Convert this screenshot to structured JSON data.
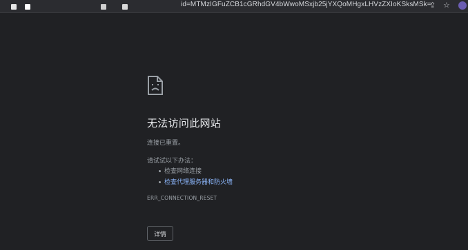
{
  "browser": {
    "url": "id=MTMzIGFuZCB1cGRhdGV4bWwoMSxjb25jYXQoMHgxLHVzZXIoKSksMSk=",
    "tab_colors": [
      "#e8e8e8",
      "#ffffff",
      "#cfcfcf",
      "#d8d8d8"
    ],
    "icons": [
      "share-icon",
      "star-icon"
    ]
  },
  "error_page": {
    "icon": "sad-page-icon",
    "title": "无法访问此网站",
    "subtitle": "连接已重置。",
    "try_heading": "请试试以下办法：",
    "suggestions": [
      {
        "label": "检查网络连接",
        "link": false
      },
      {
        "label": "检查代理服务器和防火墙",
        "link": true
      }
    ],
    "error_code": "ERR_CONNECTION_RESET",
    "details_button": "详情"
  },
  "colors": {
    "background": "#202124",
    "title": "#e8eaed",
    "text": "#9aa0a6",
    "link": "#8ab4f8"
  }
}
